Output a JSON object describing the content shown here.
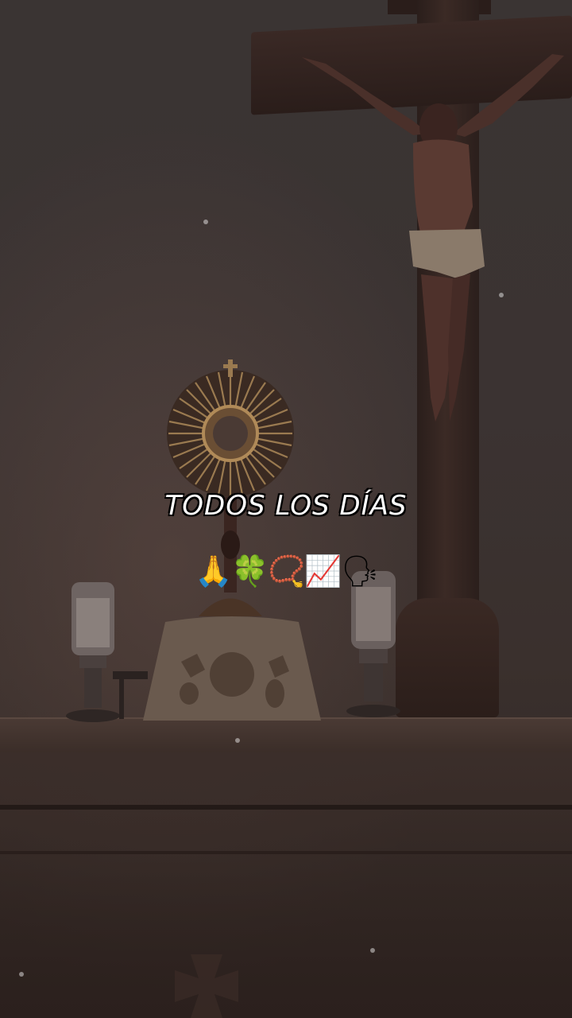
{
  "overlay": {
    "caption": "TODOS LOS DÍAS",
    "emojis": [
      "🙏",
      "🍀",
      "📿",
      "📈",
      "🗣"
    ]
  },
  "colors": {
    "wall": "#3a3433",
    "wood": "#2a1e1b",
    "gold": "#8a6a3a",
    "text": "#ffffff"
  }
}
